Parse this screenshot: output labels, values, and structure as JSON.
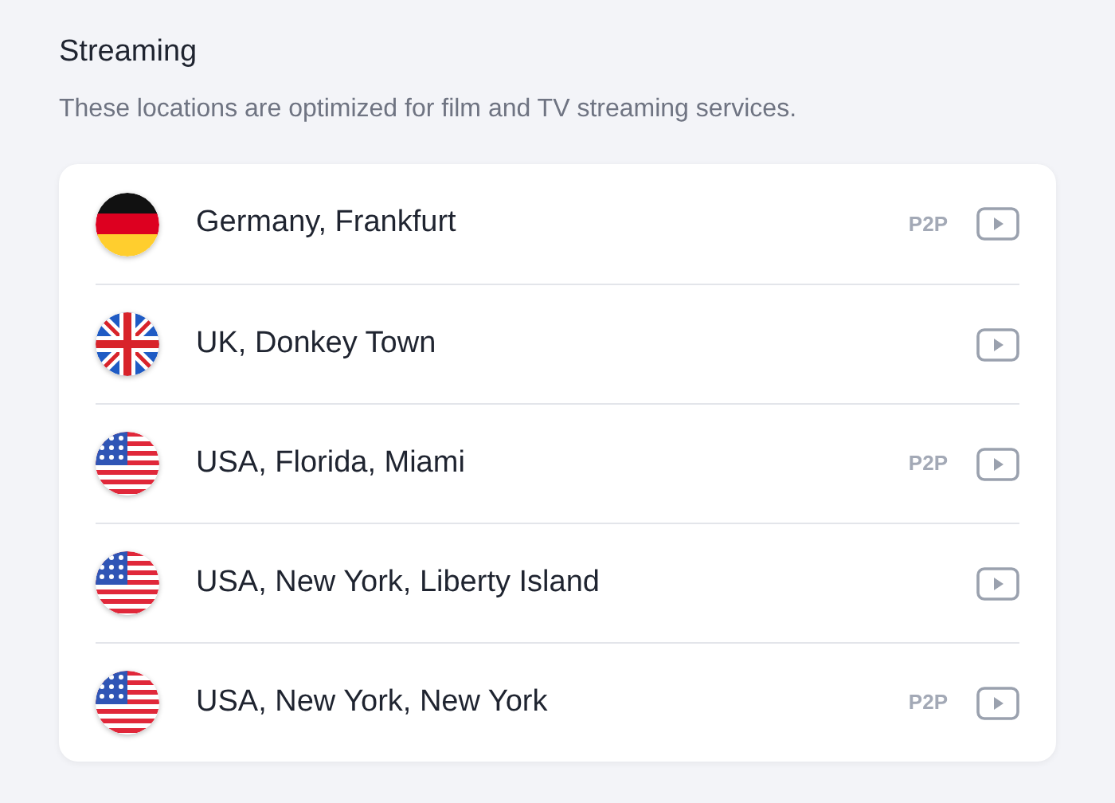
{
  "section": {
    "title": "Streaming",
    "description": "These locations are optimized for film and TV streaming services."
  },
  "locations": [
    {
      "name": "Germany, Frankfurt",
      "kind": "de",
      "badge": "P2P"
    },
    {
      "name": "UK, Donkey Town",
      "kind": "uk"
    },
    {
      "name": "USA, Florida, Miami",
      "kind": "us",
      "badge": "P2P"
    },
    {
      "name": "USA, New York, Liberty Island",
      "kind": "us"
    },
    {
      "name": "USA, New York, New York",
      "kind": "us",
      "badge": "P2P"
    }
  ]
}
